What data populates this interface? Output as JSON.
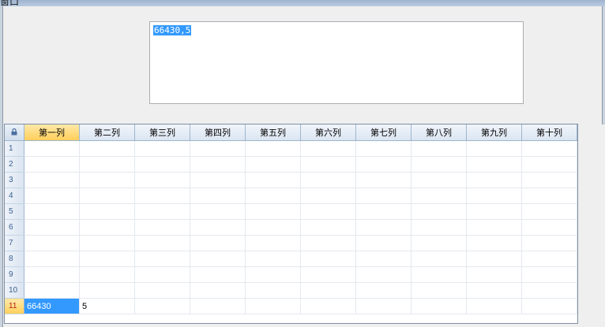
{
  "window": {
    "title": "窗口"
  },
  "textbox": {
    "value": "66430,5"
  },
  "grid": {
    "corner_icon": "lock-icon",
    "columns": [
      "第一列",
      "第二列",
      "第三列",
      "第四列",
      "第五列",
      "第六列",
      "第七列",
      "第八列",
      "第九列",
      "第十列"
    ],
    "rows": [
      {
        "num": "1",
        "cells": [
          "",
          "",
          "",
          "",
          "",
          "",
          "",
          "",
          "",
          ""
        ]
      },
      {
        "num": "2",
        "cells": [
          "",
          "",
          "",
          "",
          "",
          "",
          "",
          "",
          "",
          ""
        ]
      },
      {
        "num": "3",
        "cells": [
          "",
          "",
          "",
          "",
          "",
          "",
          "",
          "",
          "",
          ""
        ]
      },
      {
        "num": "4",
        "cells": [
          "",
          "",
          "",
          "",
          "",
          "",
          "",
          "",
          "",
          ""
        ]
      },
      {
        "num": "5",
        "cells": [
          "",
          "",
          "",
          "",
          "",
          "",
          "",
          "",
          "",
          ""
        ]
      },
      {
        "num": "6",
        "cells": [
          "",
          "",
          "",
          "",
          "",
          "",
          "",
          "",
          "",
          ""
        ]
      },
      {
        "num": "7",
        "cells": [
          "",
          "",
          "",
          "",
          "",
          "",
          "",
          "",
          "",
          ""
        ]
      },
      {
        "num": "8",
        "cells": [
          "",
          "",
          "",
          "",
          "",
          "",
          "",
          "",
          "",
          ""
        ]
      },
      {
        "num": "9",
        "cells": [
          "",
          "",
          "",
          "",
          "",
          "",
          "",
          "",
          "",
          ""
        ]
      },
      {
        "num": "10",
        "cells": [
          "",
          "",
          "",
          "",
          "",
          "",
          "",
          "",
          "",
          ""
        ]
      },
      {
        "num": "11",
        "cells": [
          "66430",
          "5",
          "",
          "",
          "",
          "",
          "",
          "",
          "",
          ""
        ]
      }
    ],
    "active_row": 11,
    "active_column": 1,
    "colors": {
      "selection": "#3399ff",
      "active_header": "#ffcf5a",
      "header": "#dbe5f1"
    }
  }
}
